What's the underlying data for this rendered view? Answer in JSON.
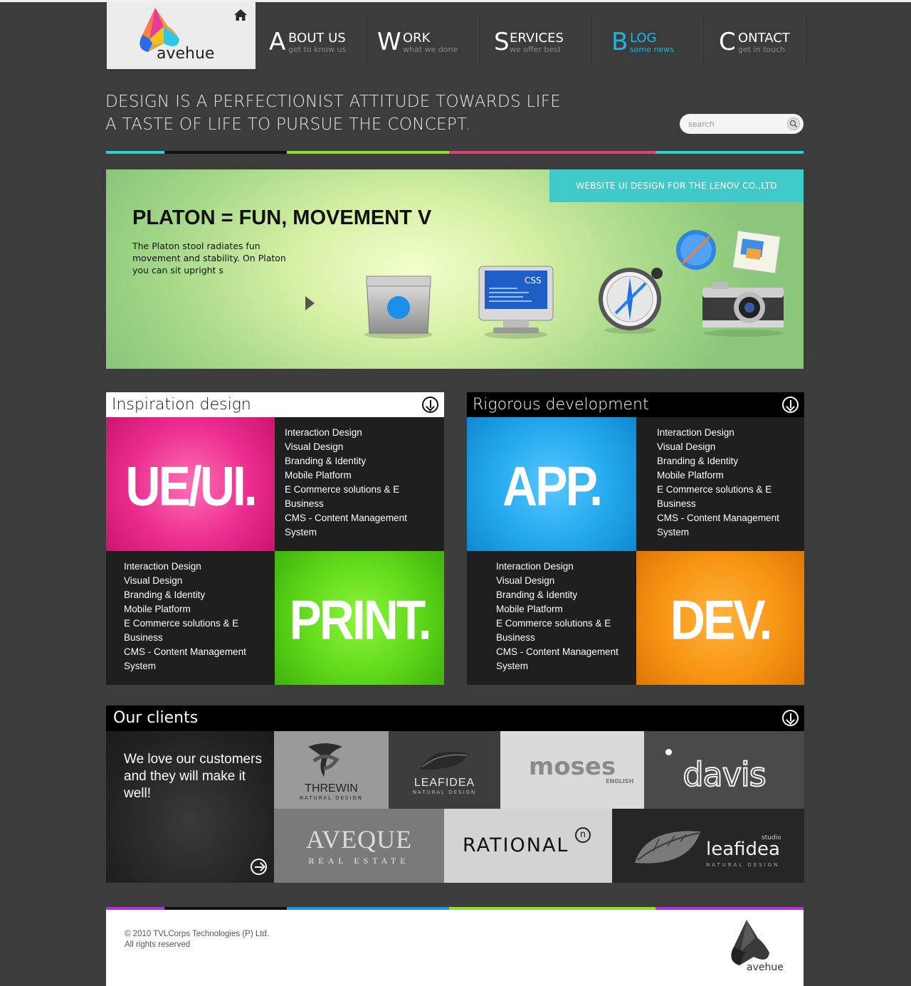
{
  "header": {
    "logo_text": "avehue",
    "nav": [
      {
        "letter": "A",
        "title": "BOUT US",
        "sub": "get to know us"
      },
      {
        "letter": "W",
        "title": "ORK",
        "sub": "what we done"
      },
      {
        "letter": "S",
        "title": "ERVICES",
        "sub": "we offer best"
      },
      {
        "letter": "B",
        "title": "LOG",
        "sub": "some news"
      },
      {
        "letter": "C",
        "title": "ONTACT",
        "sub": "get in touch"
      }
    ],
    "active_nav": "BLOG"
  },
  "tagline": {
    "line1": "DESIGN IS A PERFECTIONIST ATTITUDE TOWARDS LIFE",
    "line2": "A TASTE OF LIFE TO PURSUE THE CONCEPT."
  },
  "search": {
    "placeholder": "search"
  },
  "colors": {
    "cyan": "#22d3d3",
    "black": "#111111",
    "green": "#8ee02c",
    "pink": "#e0407a",
    "blue": "#1a9be0",
    "purple": "#b030e0",
    "active_nav": "#18b8e0"
  },
  "banner": {
    "tag": "WEBSITE UI DESIGN FOR THE LENOV CO.,LTD",
    "title": "PLATON = FUN, MOVEMENT V",
    "description": "The Platon stool radiates fun movement and stability. On Platon you can sit upright s",
    "icon_css_label": "CSS"
  },
  "inspiration": {
    "heading": "Inspiration design",
    "tile1": "UE/UI.",
    "tile2": "PRINT.",
    "list1": [
      "Interaction Design",
      "Visual Design",
      "Branding & Identity",
      "Mobile Platform",
      "E Commerce solutions & E",
      "Business",
      "CMS - Content Management",
      "System"
    ],
    "list2": [
      "Interaction Design",
      "Visual Design",
      "Branding & Identity",
      "Mobile Platform",
      "E Commerce solutions & E",
      "Business",
      "CMS - Content Management",
      "System"
    ]
  },
  "development": {
    "heading": "Rigorous development",
    "tile1": "APP.",
    "tile2": "DEV.",
    "list1": [
      "Interaction Design",
      "Visual Design",
      "Branding & Identity",
      "Mobile Platform",
      "E Commerce solutions & E",
      "Business",
      "CMS - Content Management",
      "System"
    ],
    "list2": [
      "Interaction Design",
      "Visual Design",
      "Branding & Identity",
      "Mobile Platform",
      "E Commerce solutions & E",
      "Business",
      "CMS - Content Management",
      "System"
    ]
  },
  "clients": {
    "heading": "Our clients",
    "intro": "We love our customers and they will make it well!",
    "logos": [
      {
        "name": "THREWIN",
        "sub": "NATURAL DESIGN"
      },
      {
        "name": "LEAFIDEA",
        "sub": "NATURAL DESIGN"
      },
      {
        "name": "moses",
        "sub": "ENGLISH"
      },
      {
        "name": "davis",
        "sub": ""
      },
      {
        "name": "AVEQUE",
        "sub": "REAL ESTATE"
      },
      {
        "name": "RATIONAL",
        "sub": "n"
      },
      {
        "name": "leafidea",
        "sub": "NATURAL DESIGN",
        "tag": "studio"
      }
    ]
  },
  "footer": {
    "copyright": "© 2010 TVLCorps Technologies (P) Ltd.",
    "rights": "All rights reserved",
    "logo_text": "avehue"
  }
}
